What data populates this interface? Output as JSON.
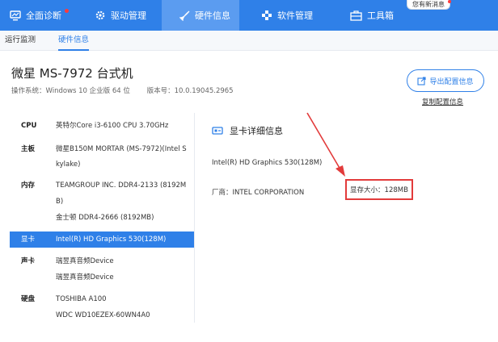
{
  "nav": {
    "items": [
      {
        "label": "全面诊断",
        "icon": "monitor-icon"
      },
      {
        "label": "驱动管理",
        "icon": "gear-icon"
      },
      {
        "label": "硬件信息",
        "icon": "rocket-icon"
      },
      {
        "label": "软件管理",
        "icon": "cube-icon"
      },
      {
        "label": "工具箱",
        "icon": "toolbox-icon"
      }
    ],
    "message_badge": "您有新消息"
  },
  "subtabs": [
    "运行监测",
    "硬件信息"
  ],
  "header": {
    "title": "微星 MS-7972 台式机",
    "os_label": "操作系统：Windows 10 企业版 64 位",
    "version_label": "版本号：10.0.19045.2965",
    "export_button": "导出配置信息",
    "copy_link": "复制配置信息"
  },
  "hardware": [
    {
      "label": "CPU",
      "lines": [
        "英特尔Core i3-6100 CPU 3.70GHz"
      ]
    },
    {
      "label": "主板",
      "lines": [
        "微星B150M MORTAR (MS-7972)(Intel S",
        "kylake)"
      ]
    },
    {
      "label": "内存",
      "lines": [
        "TEAMGROUP INC. DDR4-2133 (8192M",
        "B)",
        "金士顿 DDR4-2666 (8192MB)"
      ]
    },
    {
      "label": "显卡",
      "lines": [
        "Intel(R) HD Graphics 530(128M)"
      ]
    },
    {
      "label": "声卡",
      "lines": [
        "瑞昱真音频Device",
        "瑞昱真音频Device"
      ]
    },
    {
      "label": "硬盘",
      "lines": [
        "TOSHIBA A100",
        "WDC WD10EZEX-60WN4A0"
      ]
    }
  ],
  "detail": {
    "title": "显卡详细信息",
    "gpu_name": "Intel(R) HD Graphics 530(128M)",
    "vendor": "厂商：INTEL CORPORATION",
    "vram": "显存大小：128MB"
  },
  "colors": {
    "accent": "#2f80e8",
    "highlight": "#e23b3b"
  }
}
